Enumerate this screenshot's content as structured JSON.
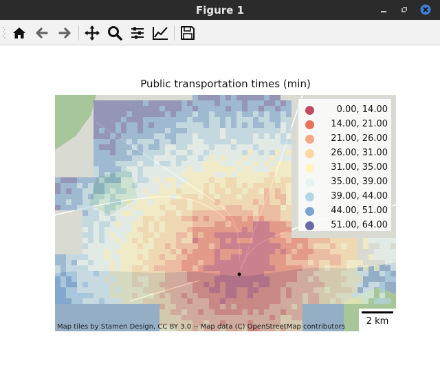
{
  "window": {
    "title": "Figure 1",
    "buttons": [
      "minimize",
      "restore",
      "close"
    ]
  },
  "toolbar": {
    "tools": [
      {
        "name": "home",
        "icon": "home-icon"
      },
      {
        "name": "back",
        "icon": "arrow-left-icon"
      },
      {
        "name": "forward",
        "icon": "arrow-right-icon"
      },
      {
        "name": "pan",
        "icon": "move-icon"
      },
      {
        "name": "zoom",
        "icon": "zoom-icon"
      },
      {
        "name": "configure-subplots",
        "icon": "sliders-icon"
      },
      {
        "name": "edit-axis",
        "icon": "chart-line-icon"
      },
      {
        "name": "save",
        "icon": "save-icon"
      }
    ]
  },
  "figure": {
    "title": "Public transportation times (min)",
    "legend": [
      {
        "label": "0.00, 14.00",
        "color": "#c04a62"
      },
      {
        "label": "14.00, 21.00",
        "color": "#e8725c"
      },
      {
        "label": "21.00, 26.00",
        "color": "#f5a884"
      },
      {
        "label": "26.00, 31.00",
        "color": "#fbd8a0"
      },
      {
        "label": "31.00, 35.00",
        "color": "#fdf6bf"
      },
      {
        "label": "35.00, 39.00",
        "color": "#e6f3f2"
      },
      {
        "label": "39.00, 44.00",
        "color": "#b4d6e6"
      },
      {
        "label": "44.00, 51.00",
        "color": "#7aa4cf"
      },
      {
        "label": "51.00, 64.00",
        "color": "#6a6aa8"
      }
    ],
    "attribution": "Map tiles by Stamen Design, CC BY 3.0 -- Map data (C) OpenStreetMap contributors",
    "scalebar": "2 km"
  },
  "colors": {
    "titlebar": "#2b2b2b",
    "toolbar": "#f2f2f2",
    "water": "#94aec6",
    "land": "#d9dbd3",
    "green": "#a7c69a"
  }
}
